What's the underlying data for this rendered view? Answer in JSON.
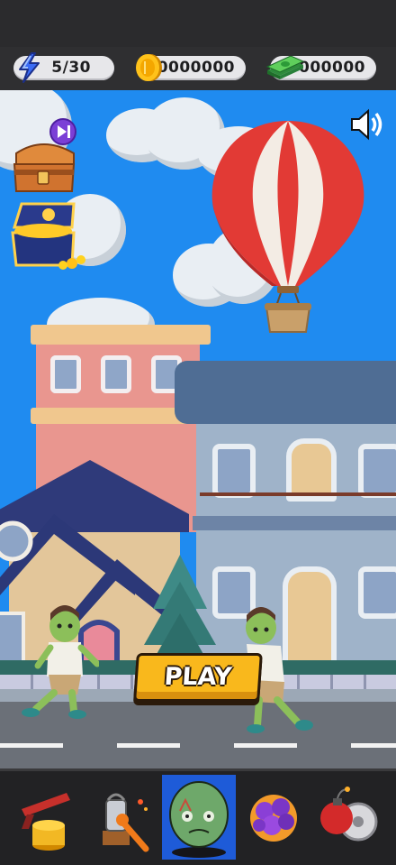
{
  "resources": {
    "energy": {
      "value": "5/30",
      "icon": "lightning-icon"
    },
    "coins": {
      "value": "0000000",
      "icon": "gold-coin-icon"
    },
    "cash": {
      "value": "000000",
      "icon": "cash-stack-icon"
    }
  },
  "play_button": {
    "label": "PLAY"
  },
  "side_items": [
    "treasure-chest-video-reward",
    "open-treasure-chest"
  ],
  "nav": {
    "items": [
      "weapons-tab",
      "workshop-tab",
      "zombies-tab",
      "boosters-tab",
      "bombs-tab"
    ],
    "active": "zombies-tab"
  },
  "colors": {
    "sky": "#1f8bf0",
    "play_bg": "#f9b81c",
    "nav_active": "#1e5bd8",
    "topbar": "#2b2b2d"
  }
}
